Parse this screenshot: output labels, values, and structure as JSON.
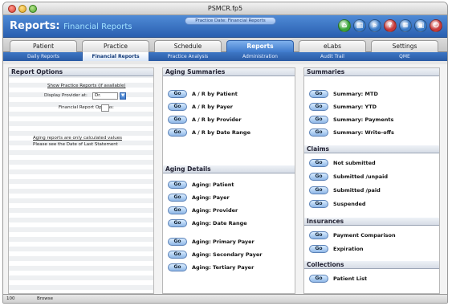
{
  "window": {
    "title": "PSMCR.fp5"
  },
  "banner": {
    "title": "Reports:",
    "subtitle": "Financial Reports",
    "pill": "Practice Date: Financial Reports"
  },
  "toolbar_icons": [
    {
      "name": "home-icon",
      "glyph": "⌂",
      "color": "#3aa53a"
    },
    {
      "name": "print-icon",
      "glyph": "▤",
      "color": "#3a7bc8"
    },
    {
      "name": "search-icon",
      "glyph": "⌕",
      "color": "#3a7bc8"
    },
    {
      "name": "help-icon",
      "glyph": "?",
      "color": "#c83a3a"
    },
    {
      "name": "settings-icon",
      "glyph": "≡",
      "color": "#3a7bc8"
    },
    {
      "name": "save-icon",
      "glyph": "▣",
      "color": "#3a7bc8"
    },
    {
      "name": "logout-icon",
      "glyph": "⏻",
      "color": "#c83a3a"
    }
  ],
  "tabs": [
    "Patient",
    "Practice",
    "Schedule",
    "Reports",
    "eLabs",
    "Settings"
  ],
  "subtabs": [
    "Daily Reports",
    "Financial Reports",
    "Practice Analysis",
    "Administration",
    "Audit Trail",
    "QME"
  ],
  "report_options": {
    "title": "Report Options",
    "header_link": "Show Practice Reports (if available)",
    "display_label": "Display Provider at:",
    "display_value": "Dr. ",
    "range_label": "Financial Report Options:",
    "range_value": "",
    "note_line1": "Aging reports are only calculated values",
    "note_line2": "Please see the Date of Last Statement"
  },
  "aging_summaries": {
    "title": "Aging Summaries",
    "items": [
      "A / R by Patient",
      "A / R by Payer",
      "A / R by Provider",
      "A / R by Date Range"
    ]
  },
  "aging_details": {
    "title": "Aging Details",
    "items": [
      "Aging: Patient",
      "Aging: Payer",
      "Aging: Provider",
      "Aging: Date Range",
      "Aging: Primary Payer",
      "Aging: Secondary Payer",
      "Aging: Tertiary Payer"
    ]
  },
  "summaries": {
    "title": "Summaries",
    "items": [
      "Summary: MTD",
      "Summary: YTD",
      "Summary: Payments",
      "Summary: Write-offs"
    ]
  },
  "claims": {
    "title": "Claims",
    "items": [
      "Not submitted",
      "Submitted /unpaid",
      "Submitted /paid",
      "Suspended"
    ]
  },
  "insurances": {
    "title": "Insurances",
    "items": [
      "Payment Comparison",
      "Expiration"
    ]
  },
  "collections": {
    "title": "Collections",
    "items": [
      "Patient List"
    ]
  },
  "go_label": "Go",
  "status": {
    "zoom": "100",
    "mode": "Browse"
  }
}
